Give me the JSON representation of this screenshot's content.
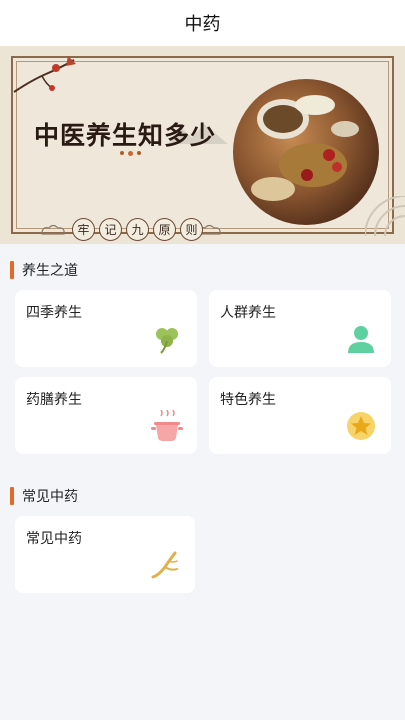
{
  "header": {
    "title": "中药"
  },
  "banner": {
    "title": "中医养生知多少",
    "subtitle_chars": [
      "牢",
      "记",
      "九",
      "原",
      "则"
    ]
  },
  "sections": [
    {
      "title": "养生之道",
      "cards": [
        {
          "label": "四季养生",
          "icon": "ginkgo-leaf-icon",
          "color": "#9cc25a"
        },
        {
          "label": "人群养生",
          "icon": "people-icon",
          "color": "#5fd0a0"
        },
        {
          "label": "药膳养生",
          "icon": "pot-icon",
          "color": "#f08a8a"
        },
        {
          "label": "特色养生",
          "icon": "star-icon",
          "color": "#f2c038"
        }
      ]
    },
    {
      "title": "常见中药",
      "cards": [
        {
          "label": "常见中药",
          "icon": "herb-root-icon",
          "color": "#e0b04a"
        }
      ]
    }
  ],
  "colors": {
    "accent": "#e26a2c",
    "background": "#f4f5f9"
  }
}
